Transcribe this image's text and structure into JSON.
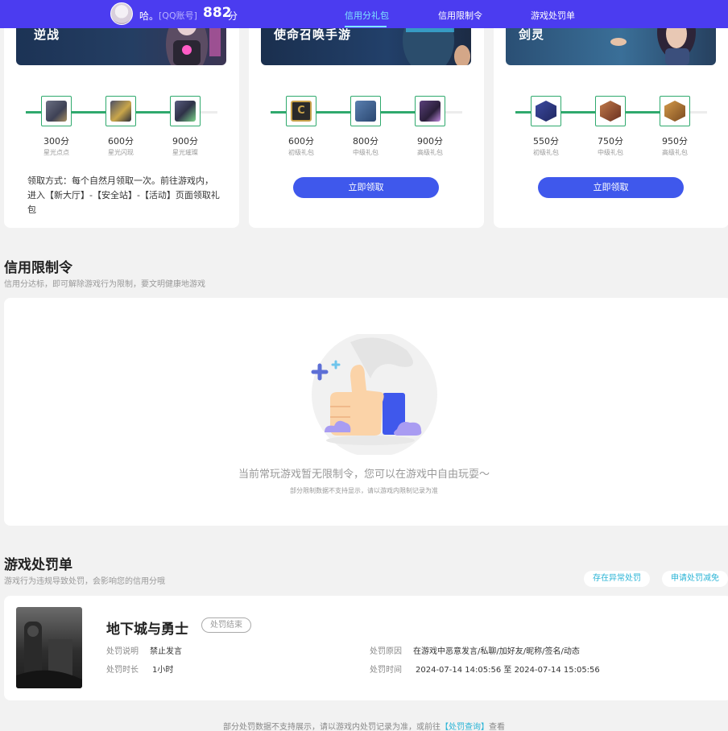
{
  "topbar": {
    "nickname": "哈。",
    "account_type": "[QQ账号]",
    "score": "882",
    "score_unit": "分",
    "nav": [
      "信用分礼包",
      "信用限制令",
      "游戏处罚单"
    ],
    "active_nav": "信用分礼包"
  },
  "gift_cards": [
    {
      "banner_title": "逆战",
      "gifts": [
        {
          "points": "300分",
          "name": "星光点点",
          "icon": "nz-gift-1-icon"
        },
        {
          "points": "600分",
          "name": "星光闪现",
          "icon": "nz-gift-2-icon"
        },
        {
          "points": "900分",
          "name": "星光璀璨",
          "icon": "nz-gift-3-icon"
        }
      ],
      "claim_text": "领取方式：每个自然月领取一次。前往游戏内，进入【新大厅】-【安全站】-【活动】页面领取礼包"
    },
    {
      "banner_title": "使命召唤手游",
      "gifts": [
        {
          "points": "600分",
          "name": "初级礼包",
          "icon": "codm-gift-1-icon"
        },
        {
          "points": "800分",
          "name": "中级礼包",
          "icon": "codm-gift-2-icon"
        },
        {
          "points": "900分",
          "name": "高级礼包",
          "icon": "codm-gift-3-icon"
        }
      ],
      "claim_button": "立即领取"
    },
    {
      "banner_title": "剑灵",
      "gifts": [
        {
          "points": "550分",
          "name": "初级礼包",
          "icon": "bns-gift-1-icon"
        },
        {
          "points": "750分",
          "name": "中级礼包",
          "icon": "bns-gift-2-icon"
        },
        {
          "points": "950分",
          "name": "高级礼包",
          "icon": "bns-gift-3-icon"
        }
      ],
      "claim_button": "立即领取"
    }
  ],
  "restriction": {
    "title": "信用限制令",
    "subtitle": "信用分达标，即可解除游戏行为限制，要文明健康地游戏",
    "empty_text": "当前常玩游戏暂无限制令，您可以在游戏中自由玩耍～",
    "empty_note": "部分限制数据不支持显示，请以游戏内限制记录为准"
  },
  "penalty": {
    "title": "游戏处罚单",
    "subtitle": "游戏行为违规导致处罚，会影响您的信用分哦",
    "btn_abnormal": "存在异常处罚",
    "btn_reduce": "申请处罚减免",
    "record": {
      "game": "地下城与勇士",
      "status": "处罚结束",
      "desc_label": "处罚说明",
      "desc_value": "禁止发言",
      "duration_label": "处罚时长",
      "duration_value": "1小时",
      "reason_label": "处罚原因",
      "reason_value": "在游戏中恶意发言/私聊/加好友/昵称/签名/动态",
      "time_label": "处罚时间",
      "time_value": "2024-07-14 14:05:56 至 2024-07-14 15:05:56"
    },
    "footer_prefix": "部分处罚数据不支持展示，请以游戏内处罚记录为准，或前往",
    "footer_link": "【处罚查询】",
    "footer_suffix": "查看"
  },
  "colors": {
    "topbar": "#4b3cf0",
    "accent": "#3f58ec",
    "progress": "#2fa96d",
    "link": "#2bb4d6"
  }
}
